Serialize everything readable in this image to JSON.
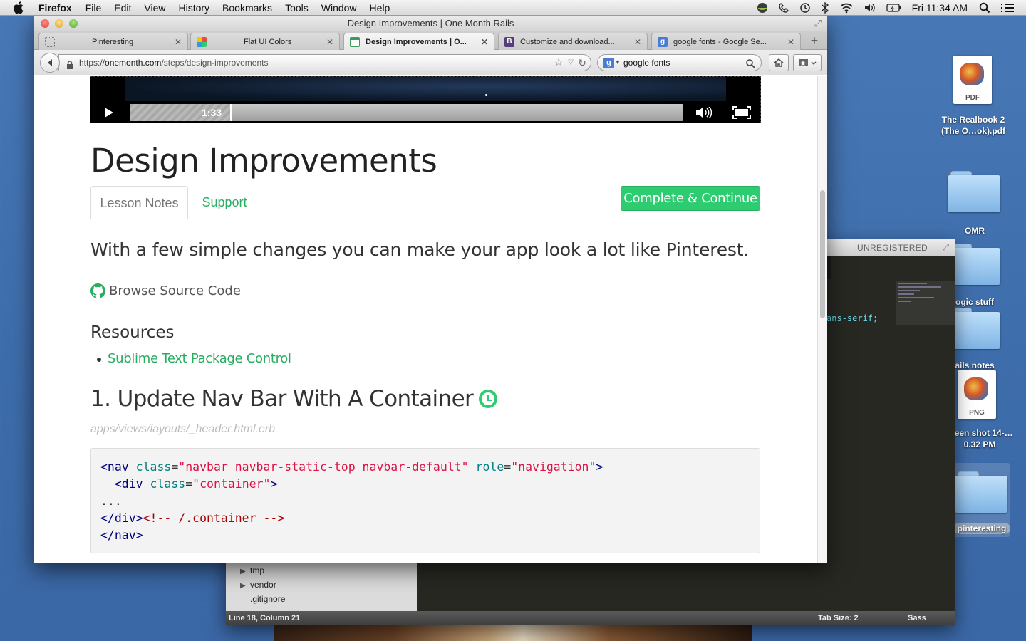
{
  "menubar": {
    "app": "Firefox",
    "items": [
      "File",
      "Edit",
      "View",
      "History",
      "Bookmarks",
      "Tools",
      "Window",
      "Help"
    ],
    "clock": "Fri 11:34 AM"
  },
  "editor": {
    "unregistered": "UNREGISTERED",
    "code_fragment": "ans-serif;",
    "sidebar": [
      "tmp",
      "vendor",
      ".gitignore"
    ],
    "status": {
      "position": "Line 18, Column 21",
      "tab_size": "Tab Size: 2",
      "syntax": "Sass"
    }
  },
  "desktop": {
    "icons": [
      {
        "name": "The Realbook 2 (The O…ok).pdf",
        "badge": "PDF"
      },
      {
        "name": "OMR"
      },
      {
        "name": "ogic stuff"
      },
      {
        "name": "ails notes"
      },
      {
        "name": "creen shot 14-…0.32 PM",
        "badge": "PNG"
      },
      {
        "name": "pinteresting"
      }
    ]
  },
  "browser": {
    "window_title": "Design Improvements | One Month Rails",
    "tabs": [
      {
        "title": "Pinteresting"
      },
      {
        "title": "Flat UI Colors"
      },
      {
        "title": "Design Improvements | O..."
      },
      {
        "title": "Customize and download..."
      },
      {
        "title": "google fonts - Google Se..."
      }
    ],
    "url_scheme": "https://",
    "url_host": "onemonth.com",
    "url_path": "/steps/design-improvements",
    "search_value": "google fonts",
    "accent": "#2ecc71"
  },
  "page": {
    "video_time": "1:33",
    "video_progress": 0.18,
    "title": "Design Improvements",
    "tab_notes": "Lesson Notes",
    "tab_support": "Support",
    "complete_button": "Complete & Continue",
    "lead": "With a few simple changes you can make your app look a lot like Pinterest.",
    "browse_source": "Browse Source Code",
    "resources_heading": "Resources",
    "resource_link": "Sublime Text Package Control",
    "step_heading": "1. Update Nav Bar With A Container",
    "file_path": "apps/views/layouts/_header.html.erb",
    "code": {
      "l1_open": "<nav ",
      "l1_a1": "class",
      "l1_v1": "\"navbar navbar-static-top navbar-default\"",
      "l1_a2": "role",
      "l1_v2": "\"navigation\"",
      "l1_close": ">",
      "l2_open": "  <div ",
      "l2_a1": "class",
      "l2_v1": "\"container\"",
      "l2_close": ">",
      "l3": "...",
      "l4_tag": "</div>",
      "l4_comment": "<!-- /.container -->",
      "l5": "</nav>"
    }
  }
}
